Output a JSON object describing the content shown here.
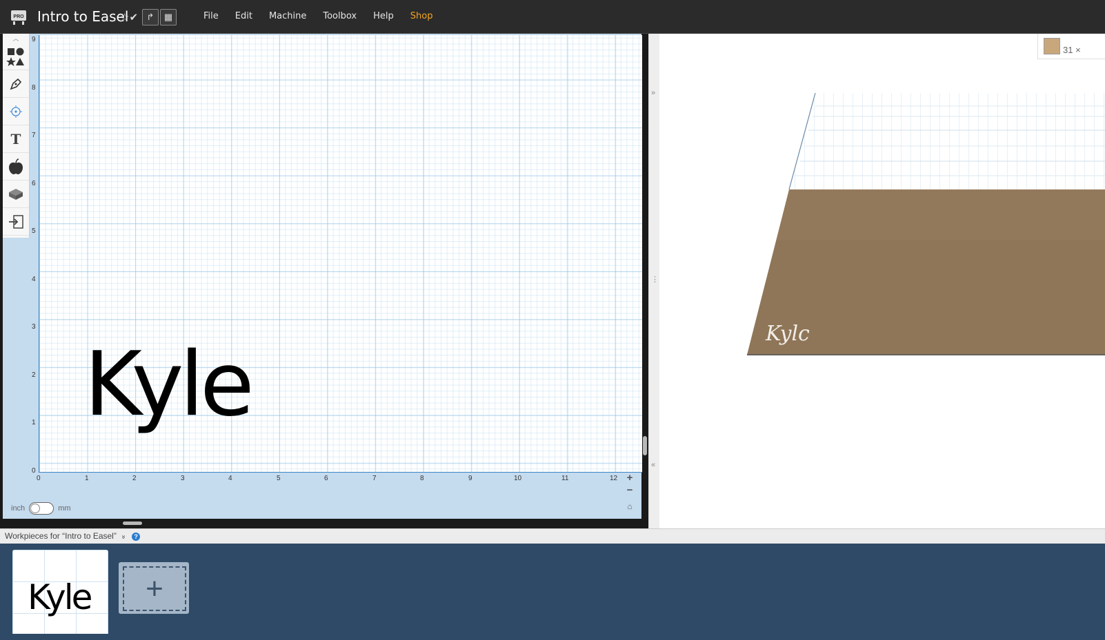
{
  "app": {
    "badge": "PRO",
    "title": "Intro to Easel",
    "status_icons": "☆✔",
    "share_icon": "↱",
    "view_icon": "▦"
  },
  "menu": {
    "items": [
      "File",
      "Edit",
      "Machine",
      "Toolbox",
      "Help"
    ],
    "shop": "Shop",
    "shop_color": "#f5a623"
  },
  "tools": [
    {
      "name": "shapes-icon",
      "glyph": "■●"
    },
    {
      "name": "pen-icon",
      "glyph": "✎"
    },
    {
      "name": "target-icon",
      "glyph": "⊙"
    },
    {
      "name": "text-icon",
      "glyph": "T"
    },
    {
      "name": "apple-icon",
      "glyph": "●"
    },
    {
      "name": "box-icon",
      "glyph": "▰"
    },
    {
      "name": "import-icon",
      "glyph": "⇥"
    }
  ],
  "axes": {
    "x_ticks": [
      "0",
      "1",
      "2",
      "3",
      "4",
      "5",
      "6",
      "7",
      "8",
      "9",
      "10",
      "11",
      "12"
    ],
    "y_ticks": [
      "9",
      "8",
      "7",
      "6",
      "5",
      "4",
      "3",
      "2",
      "1",
      "0"
    ]
  },
  "canvas": {
    "text": "Kyle"
  },
  "units": {
    "left": "inch",
    "right": "mm"
  },
  "zoom": {
    "in": "+",
    "out": "−",
    "home": "⌂"
  },
  "divider": {
    "expand": "»",
    "handle": "⋮",
    "collapse": "«"
  },
  "preview": {
    "material_label": "31 ×",
    "material_color": "#c9a77c",
    "carved_text": "Kylc"
  },
  "workpieces": {
    "label": "Workpieces for “Intro to Easel”",
    "dropdown": "»",
    "help": "?",
    "items": [
      "Kyle"
    ],
    "add": "+"
  }
}
